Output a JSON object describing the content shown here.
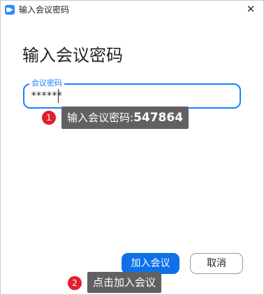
{
  "window": {
    "title": "输入会议密码",
    "close_glyph": "✕",
    "app_icon": "zoom-camera-icon"
  },
  "main": {
    "heading": "输入会议密码",
    "password_field": {
      "label": "会议密码",
      "value": "******"
    }
  },
  "buttons": {
    "join_label": "加入会议",
    "cancel_label": "取消"
  },
  "annotations": [
    {
      "number": "1",
      "text": "输入会议密码:",
      "value": "547864"
    },
    {
      "number": "2",
      "text": "点击加入会议"
    }
  ],
  "colors": {
    "accent": "#0E71EB",
    "badge": "#E0202F",
    "tooltip_bg": "#616161"
  }
}
